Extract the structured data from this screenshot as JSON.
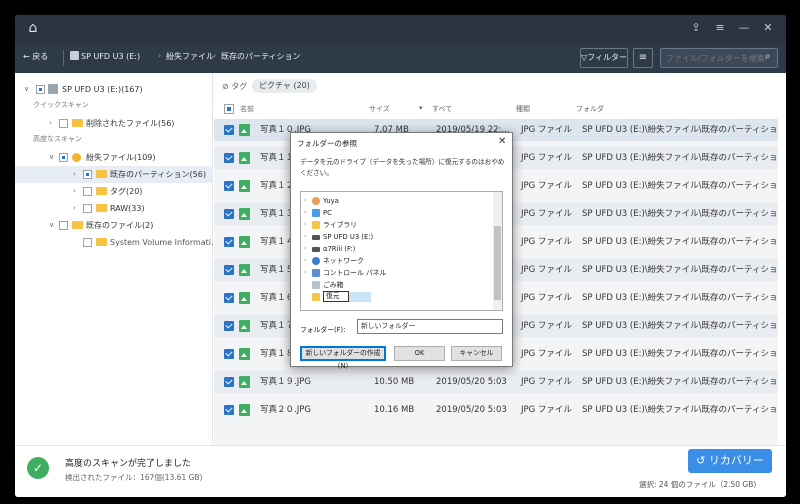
{
  "titlebar": {
    "controls": [
      "⇪",
      "≡",
      "—",
      "✕"
    ]
  },
  "toolbar": {
    "back_label": "戻る",
    "breadcrumbs": [
      "SP UFD U3 (E:)",
      "紛失ファイル",
      "既存のパーティション"
    ],
    "filter_label": "フィルター",
    "search_placeholder": "ファイル/フォルダーを検索"
  },
  "tree": {
    "drive": "SP UFD U3 (E:)(167)",
    "quick_scan_header": "クイックスキャン",
    "deleted_files": "削除されたファイル(56)",
    "advanced_scan_header": "高度なスキャン",
    "lost_files": "紛失ファイル(109)",
    "existing_partition": "既存のパーティション(56)",
    "tags": "タグ(20)",
    "raw": "RAW(33)",
    "existing_files": "既存のファイル(2)",
    "svi": "System Volume Informati..."
  },
  "tagbar": {
    "label": "タグ",
    "chip": "ピクチャ (20)"
  },
  "columns": {
    "name": "名前",
    "size": "サイズ",
    "date": "すべて",
    "type": "種類",
    "folder": "フォルダ"
  },
  "files": [
    {
      "name": "写真１０.JPG",
      "size": "7.07 MB",
      "date": "2019/05/19 22:...",
      "type": "JPG ファイル",
      "folder": "SP UFD U3 (E:)\\紛失ファイル\\既存のパーティショ"
    },
    {
      "name": "写真１１.JPG",
      "size": "",
      "date": "",
      "type": "JPG ファイル",
      "folder": "SP UFD U3 (E:)\\紛失ファイル\\既存のパーティショ"
    },
    {
      "name": "写真１２.JPG",
      "size": "",
      "date": "",
      "type": "JPG ファイル",
      "folder": "SP UFD U3 (E:)\\紛失ファイル\\既存のパーティショ"
    },
    {
      "name": "写真１３.JPG",
      "size": "",
      "date": "",
      "type": "JPG ファイル",
      "folder": "SP UFD U3 (E:)\\紛失ファイル\\既存のパーティショ"
    },
    {
      "name": "写真１４.JPG",
      "size": "",
      "date": "",
      "type": "JPG ファイル",
      "folder": "SP UFD U3 (E:)\\紛失ファイル\\既存のパーティショ"
    },
    {
      "name": "写真１５.JPG",
      "size": "",
      "date": "",
      "type": "JPG ファイル",
      "folder": "SP UFD U3 (E:)\\紛失ファイル\\既存のパーティショ"
    },
    {
      "name": "写真１６.JPG",
      "size": "",
      "date": "",
      "type": "JPG ファイル",
      "folder": "SP UFD U3 (E:)\\紛失ファイル\\既存のパーティショ"
    },
    {
      "name": "写真１７.JPG",
      "size": "",
      "date": "",
      "type": "JPG ファイル",
      "folder": "SP UFD U3 (E:)\\紛失ファイル\\既存のパーティショ"
    },
    {
      "name": "写真１８.JPG",
      "size": "",
      "date": "",
      "type": "JPG ファイル",
      "folder": "SP UFD U3 (E:)\\紛失ファイル\\既存のパーティショ"
    },
    {
      "name": "写真１９.JPG",
      "size": "10.50 MB",
      "date": "2019/05/20 5:03",
      "type": "JPG ファイル",
      "folder": "SP UFD U3 (E:)\\紛失ファイル\\既存のパーティショ"
    },
    {
      "name": "写真２０.JPG",
      "size": "10.16 MB",
      "date": "2019/05/20 5:03",
      "type": "JPG ファイル",
      "folder": "SP UFD U3 (E:)\\紛失ファイル\\既存のパーティショ"
    }
  ],
  "status": {
    "title": "高度のスキャンが完了しました",
    "subtitle": "検出されたファイル：167個(13.61 GB)",
    "recover_label": "リカバリー",
    "selection": "選択: 24 個のファイル（2.50 GB)"
  },
  "dialog": {
    "title": "フォルダーの参照",
    "message": "データを元のドライブ（データを失った場所）に復元するのはおやめください。",
    "tree_items": [
      "Yuya",
      "PC",
      "ライブラリ",
      "SP UFD U3 (E:)",
      "α7Riii (F:)",
      "ネットワーク",
      "コントロール パネル",
      "ごみ箱"
    ],
    "editing_value": "復元",
    "folder_label": "フォルダー(F):",
    "folder_value": "新しいフォルダー",
    "new_folder_label": "新しいフォルダーの作成(N)",
    "ok_label": "OK",
    "cancel_label": "キャンセル"
  }
}
